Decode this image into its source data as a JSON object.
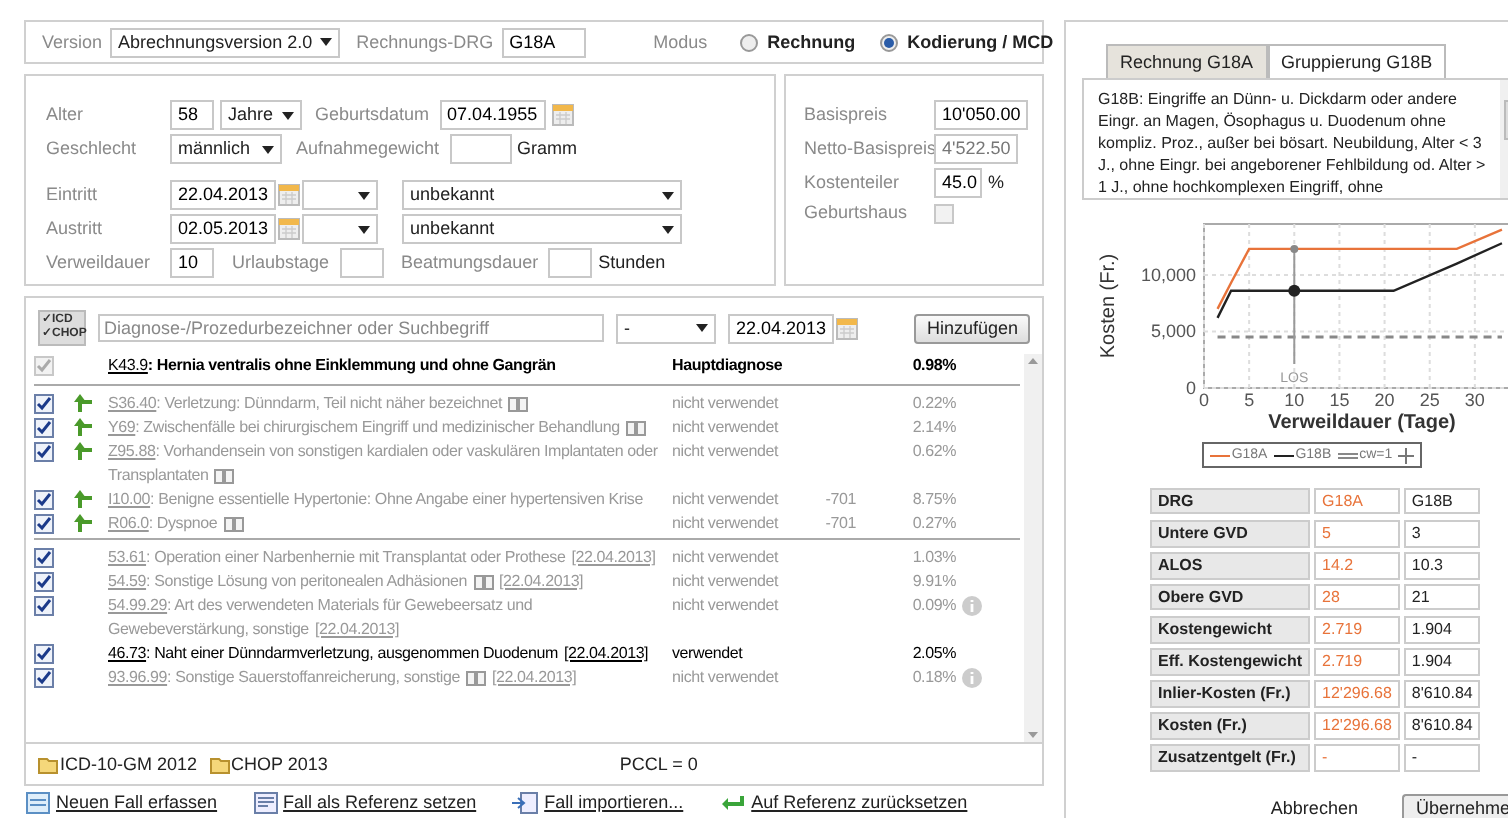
{
  "header": {
    "version_label": "Version",
    "version": "Abrechnungsversion 2.0",
    "drg_label": "Rechnungs-DRG",
    "drg": "G18A",
    "mode_label": "Modus",
    "modes": [
      {
        "label": "Rechnung",
        "selected": false
      },
      {
        "label": "Kodierung / MCD",
        "selected": true
      }
    ]
  },
  "patient": {
    "age_label": "Alter",
    "age": "58",
    "age_unit": "Jahre",
    "birth_label": "Geburtsdatum",
    "birth": "07.04.1955",
    "sex_label": "Geschlecht",
    "sex": "männlich",
    "weight_label": "Aufnahmegewicht",
    "weight_unit": "Gramm",
    "admission_label": "Eintritt",
    "admission": "22.04.2013",
    "admission_type": "unbekannt",
    "discharge_label": "Austritt",
    "discharge": "02.05.2013",
    "discharge_type": "unbekannt",
    "los_label": "Verweildauer",
    "los": "10",
    "leave_label": "Urlaubstage",
    "ventilation_label": "Beatmungsdauer",
    "ventilation_unit": "Stunden"
  },
  "pricing": {
    "base_label": "Basispreis",
    "base": "10'050.00",
    "net_label": "Netto-Basispreis",
    "net": "4'522.50",
    "share_label": "Kostenteiler",
    "share": "45.0",
    "share_unit": "%",
    "birth_house_label": "Geburtshaus",
    "birth_house_checked": false
  },
  "coding": {
    "filter_button": [
      "✓ICD",
      "✓CHOP"
    ],
    "search_placeholder": "Diagnose-/Prozedurbezeichner oder Suchbegriff",
    "side": "-",
    "date": "22.04.2013",
    "add_button": "Hinzufügen",
    "groups": [
      [
        {
          "checked": true,
          "disabled": true,
          "arrow": false,
          "code": "K43.9",
          "text": ": Hernia ventralis ohne Einklemmung und ohne Gangrän",
          "book": false,
          "status": "Hauptdiagnose",
          "used": true,
          "percent": "0.98%",
          "info": false
        }
      ],
      [
        {
          "checked": true,
          "disabled": false,
          "arrow": true,
          "code": "S36.40",
          "text": ": Verletzung: Dünndarm, Teil nicht näher bezeichnet",
          "book": true,
          "status": "nicht verwendet",
          "used": false,
          "percent": "0.22%",
          "info": false
        },
        {
          "checked": true,
          "disabled": false,
          "arrow": true,
          "code": "Y69",
          "text": ": Zwischenfälle bei chirurgischem Eingriff und medizinischer Behandlung",
          "book": true,
          "status": "nicht verwendet",
          "used": false,
          "percent": "2.14%",
          "info": false
        },
        {
          "checked": true,
          "disabled": false,
          "arrow": true,
          "code": "Z95.88",
          "text": ": Vorhandensein von sonstigen kardialen oder vaskulären Implantaten oder Transplantaten",
          "book": true,
          "status": "nicht verwendet",
          "used": false,
          "percent": "0.62%",
          "info": false
        },
        {
          "checked": true,
          "disabled": false,
          "arrow": true,
          "code": "I10.00",
          "text": ": Benigne essentielle Hypertonie: Ohne Angabe einer hypertensiven Krise",
          "book": false,
          "status": "nicht verwendet",
          "used": false,
          "column_4": "-701",
          "percent": "8.75%",
          "info": false
        },
        {
          "checked": true,
          "disabled": false,
          "arrow": true,
          "code": "R06.0",
          "text": ": Dyspnoe",
          "book": true,
          "status": "nicht verwendet",
          "used": false,
          "column_4": "-701",
          "percent": "0.27%",
          "info": false
        }
      ],
      [
        {
          "checked": true,
          "disabled": false,
          "arrow": false,
          "code": "53.61",
          "text": ": Operation einer Narbenhernie mit Transplantat oder Prothese",
          "book": false,
          "date": "[22.04.2013]",
          "status": "nicht verwendet",
          "used": false,
          "percent": "1.03%",
          "info": false
        },
        {
          "checked": true,
          "disabled": false,
          "arrow": false,
          "code": "54.59",
          "text": ": Sonstige Lösung von peritonealen Adhäsionen",
          "book": true,
          "date": "[22.04.2013]",
          "status": "nicht verwendet",
          "used": false,
          "percent": "9.91%",
          "info": false
        },
        {
          "checked": true,
          "disabled": false,
          "arrow": false,
          "code": "54.99.29",
          "text": ": Art des verwendeten Materials für Gewebeersatz und Gewebeverstärkung, sonstige",
          "book": false,
          "date": "[22.04.2013]",
          "status": "nicht verwendet",
          "used": false,
          "percent": "0.09%",
          "info": true
        },
        {
          "checked": true,
          "disabled": false,
          "arrow": false,
          "code": "46.73",
          "text": ": Naht einer Dünndarmverletzung, ausgenommen Duodenum",
          "book": false,
          "date": "[22.04.2013]",
          "status": "verwendet",
          "used": true,
          "percent": "2.05%",
          "info": false
        },
        {
          "checked": true,
          "disabled": false,
          "arrow": false,
          "code": "93.96.99",
          "text": ": Sonstige Sauerstoffanreicherung, sonstige",
          "book": true,
          "date": "[22.04.2013]",
          "status": "nicht verwendet",
          "used": false,
          "percent": "0.18%",
          "info": true
        }
      ]
    ],
    "catalogs": [
      "ICD-10-GM 2012",
      "CHOP 2013"
    ],
    "pccl": "PCCL = 0"
  },
  "links": [
    {
      "kind": "new",
      "label": "Neuen Fall erfassen"
    },
    {
      "kind": "reference",
      "label": "Fall als Referenz setzen"
    },
    {
      "kind": "import",
      "label": "Fall importieren..."
    },
    {
      "kind": "reset",
      "label": "Auf Referenz zurücksetzen"
    }
  ],
  "grouping": {
    "tabs": [
      {
        "label": "Rechnung G18A",
        "selected": false
      },
      {
        "label": "Gruppierung G18B",
        "selected": true
      }
    ],
    "description": "G18B: Eingriffe an Dünn- u. Dickdarm oder andere Eingr. an Magen, Ösophagus u. Duodenum ohne kompliz. Proz., außer bei bösart. Neubildung, Alter < 3 J., ohne Eingr. bei angeborener Fehlbildung od. Alter > 1 J., ohne hochkomplexen Eingriff, ohne",
    "chart_data": {
      "type": "line",
      "xlabel": "Verweildauer (Tage)",
      "ylabel": "Kosten (Fr.)",
      "x": [
        1.5,
        3,
        5,
        21,
        28,
        33
      ],
      "series": [
        {
          "name": "G18A",
          "color": "#e8733a",
          "values": [
            7000,
            9300,
            12300,
            12300,
            12300,
            14000
          ]
        },
        {
          "name": "G18B",
          "color": "#222222",
          "values": [
            6200,
            8600,
            8600,
            8600,
            11000,
            12800
          ]
        },
        {
          "name": "cw=1",
          "color": "#888888",
          "line_style": "dashed",
          "values": [
            4500,
            4500,
            4500,
            4500,
            4500,
            4500
          ]
        }
      ],
      "xlim": [
        0,
        35
      ],
      "ylim": [
        0,
        14500
      ],
      "xticks": [
        0,
        5,
        10,
        15,
        20,
        25,
        30
      ],
      "yticks": [
        0,
        {
          "value": 5000,
          "label": "5,000"
        },
        {
          "value": 10000,
          "label": "10,000"
        }
      ],
      "grid": true,
      "ref_lines": [
        {
          "axis": "x",
          "value": 10,
          "label": "LOS"
        }
      ]
    },
    "table": {
      "columns": [
        "DRG",
        "G18A",
        "G18B"
      ],
      "groups": [
        [
          [
            "Untere GVD",
            "5",
            "3"
          ],
          [
            "ALOS",
            "14.2",
            "10.3"
          ],
          [
            "Obere GVD",
            "28",
            "21"
          ]
        ],
        [
          [
            "Kostengewicht",
            "2.719",
            "1.904"
          ],
          [
            "Eff. Kostengewicht",
            "2.719",
            "1.904"
          ],
          [
            "Inlier-Kosten (Fr.)",
            "12'296.68",
            "8'610.84"
          ],
          [
            "Kosten (Fr.)",
            "12'296.68",
            "8'610.84"
          ],
          [
            "Zusatzentgelt (Fr.)",
            "-",
            "-"
          ]
        ]
      ]
    },
    "buttons": [
      "Abbrechen",
      "Übernehme"
    ]
  }
}
